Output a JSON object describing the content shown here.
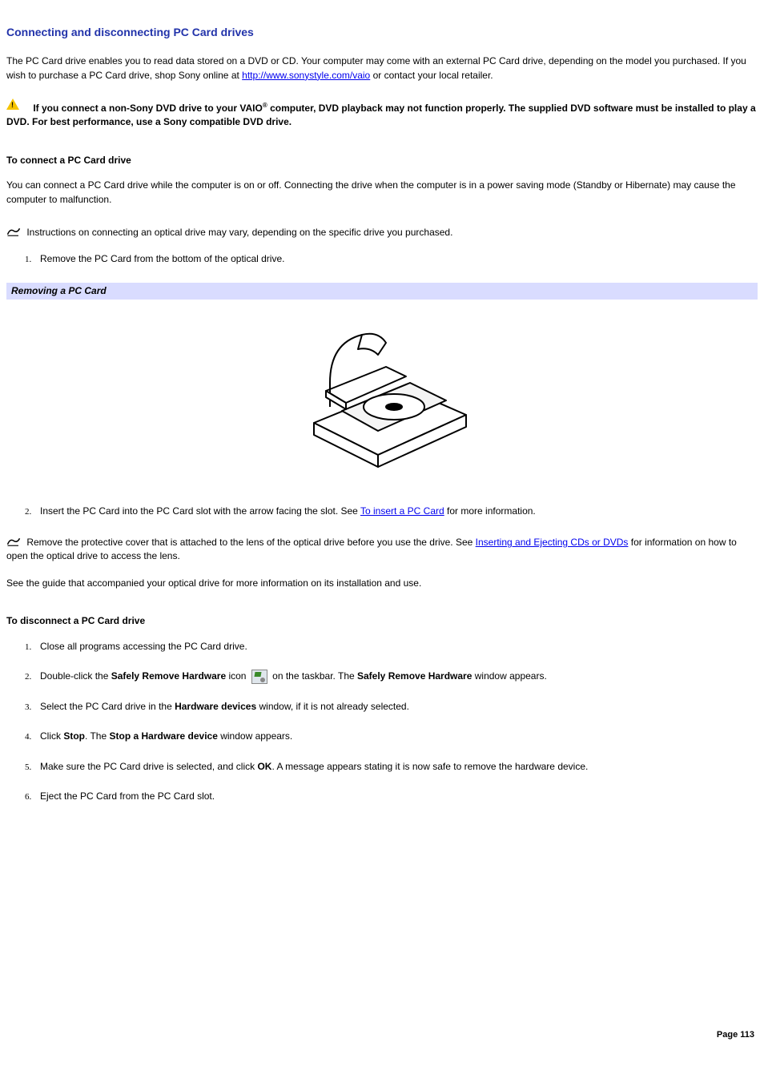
{
  "title": "Connecting and disconnecting PC Card drives",
  "intro_part1": "The PC Card drive enables you to read data stored on a DVD or CD. Your computer may come with an external PC Card drive, depending on the model you purchased. If you wish to purchase a PC Card drive, shop Sony online at ",
  "intro_link": "http://www.sonystyle.com/vaio",
  "intro_part2": " or contact your local retailer.",
  "warning_part1": "If you connect a non-Sony DVD drive to your VAIO",
  "warning_reg": "®",
  "warning_part2": " computer, DVD playback may not function properly. The supplied DVD software must be installed to play a DVD. For best performance, use a Sony compatible DVD drive.",
  "connect_header": "To connect a PC Card drive",
  "connect_para": "You can connect a PC Card drive while the computer is on or off. Connecting the drive when the computer is in a power saving mode (Standby or Hibernate) may cause the computer to malfunction.",
  "note1": "Instructions on connecting an optical drive may vary, depending on the specific drive you purchased.",
  "connect_step1": "Remove the PC Card from the bottom of the optical drive.",
  "figure_label": "Removing a PC Card",
  "connect_step2_a": "Insert the PC Card into the PC Card slot with the arrow facing the slot. See ",
  "connect_step2_link": "To insert a PC Card",
  "connect_step2_b": " for more information.",
  "note2_a": "Remove the protective cover that is attached to the lens of the optical drive before you use the drive. See ",
  "note2_link": "Inserting and Ejecting CDs or DVDs",
  "note2_b": " for information on how to open the optical drive to access the lens.",
  "guide_para": "See the guide that accompanied your optical drive for more information on its installation and use.",
  "disconnect_header": "To disconnect a PC Card drive",
  "dsteps": {
    "s1": "Close all programs accessing the PC Card drive.",
    "s2a": "Double-click the ",
    "s2b": "Safely Remove Hardware",
    "s2c": " icon ",
    "s2d": " on the taskbar. The ",
    "s2e": "Safely Remove Hardware",
    "s2f": " window appears.",
    "s3a": "Select the PC Card drive in the ",
    "s3b": "Hardware devices",
    "s3c": " window, if it is not already selected.",
    "s4a": "Click ",
    "s4b": "Stop",
    "s4c": ". The ",
    "s4d": "Stop a Hardware device",
    "s4e": " window appears.",
    "s5a": "Make sure the PC Card drive is selected, and click ",
    "s5b": "OK",
    "s5c": ". A message appears stating it is now safe to remove the hardware device.",
    "s6": "Eject the PC Card from the PC Card slot."
  },
  "page_footer": "Page 113"
}
